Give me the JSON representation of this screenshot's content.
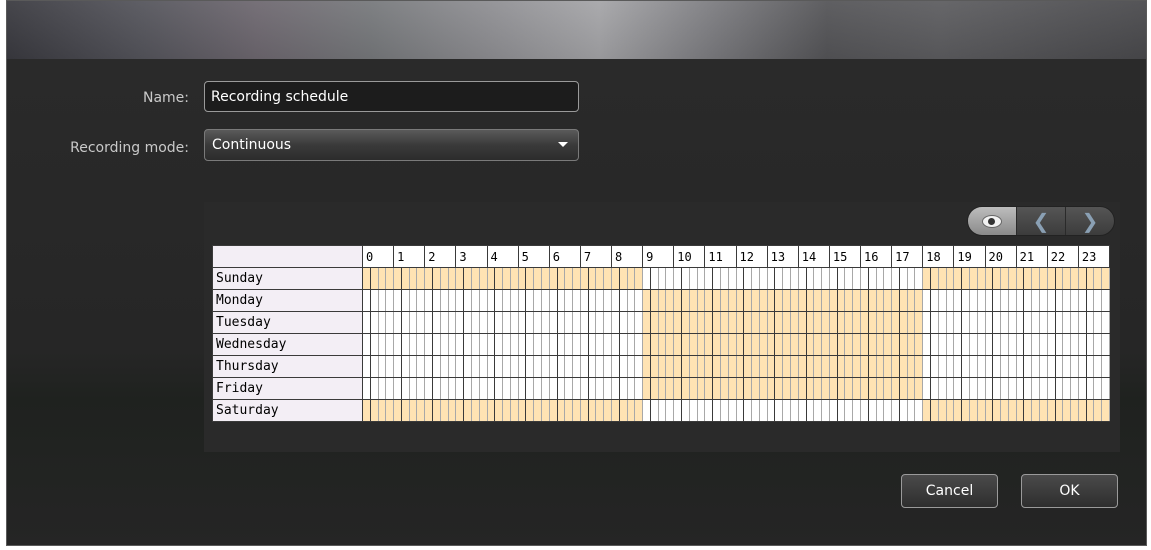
{
  "form": {
    "name_label": "Name:",
    "name_value": "Recording schedule",
    "mode_label": "Recording mode:",
    "mode_value": "Continuous"
  },
  "schedule": {
    "hours": [
      "0",
      "1",
      "2",
      "3",
      "4",
      "5",
      "6",
      "7",
      "8",
      "9",
      "10",
      "11",
      "12",
      "13",
      "14",
      "15",
      "16",
      "17",
      "18",
      "19",
      "20",
      "21",
      "22",
      "23"
    ],
    "days": [
      {
        "name": "Sunday",
        "active_hours": [
          0,
          1,
          2,
          3,
          4,
          5,
          6,
          7,
          8,
          18,
          19,
          20,
          21,
          22,
          23
        ]
      },
      {
        "name": "Monday",
        "active_hours": [
          9,
          10,
          11,
          12,
          13,
          14,
          15,
          16,
          17
        ]
      },
      {
        "name": "Tuesday",
        "active_hours": [
          9,
          10,
          11,
          12,
          13,
          14,
          15,
          16,
          17
        ]
      },
      {
        "name": "Wednesday",
        "active_hours": [
          9,
          10,
          11,
          12,
          13,
          14,
          15,
          16,
          17
        ]
      },
      {
        "name": "Thursday",
        "active_hours": [
          9,
          10,
          11,
          12,
          13,
          14,
          15,
          16,
          17
        ]
      },
      {
        "name": "Friday",
        "active_hours": [
          9,
          10,
          11,
          12,
          13,
          14,
          15,
          16,
          17
        ]
      },
      {
        "name": "Saturday",
        "active_hours": [
          0,
          1,
          2,
          3,
          4,
          5,
          6,
          7,
          8,
          18,
          19,
          20,
          21,
          22,
          23
        ]
      }
    ],
    "active_color": "#ffe3b3",
    "inactive_color": "#ffffff",
    "toolbar_icons": [
      "eye-icon",
      "chevron-left-icon",
      "chevron-right-icon"
    ]
  },
  "buttons": {
    "cancel_label": "Cancel",
    "ok_label": "OK"
  }
}
